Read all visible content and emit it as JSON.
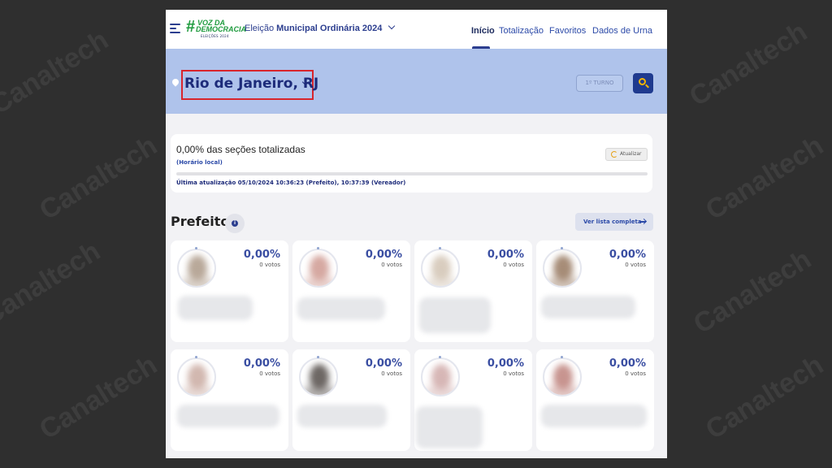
{
  "watermark": "Canaltech",
  "header": {
    "logo": {
      "hash": "#",
      "line1": "VOZ DA",
      "line2": "DEMOCRACIA",
      "sub": "ELEIÇÕES 2024"
    },
    "election_prefix": "Eleição",
    "election_name": "Municipal Ordinária 2024",
    "nav": [
      "Início",
      "Totalização",
      "Favoritos",
      "Dados de Urna"
    ],
    "active_nav": "Início"
  },
  "location": {
    "city": "Rio de Janeiro, RJ",
    "turno": "1º TURNO"
  },
  "status": {
    "percent_text": "0,00% das seções totalizadas",
    "percent_value": 0.0,
    "local_time": "(Horário local)",
    "last_update": "Última atualização 05/10/2024 10:36:23 (Prefeito), 10:37:39 (Vereador)",
    "refresh_label": "Atualizar"
  },
  "section": {
    "title": "Prefeito",
    "info": "i",
    "see_all": "Ver lista completa"
  },
  "candidates": [
    {
      "pct": "0,00%",
      "votes": "0 votos",
      "tone": "#b9a99a"
    },
    {
      "pct": "0,00%",
      "votes": "0 votos",
      "tone": "#d6a9a2"
    },
    {
      "pct": "0,00%",
      "votes": "0 votos",
      "tone": "#d9cdbf"
    },
    {
      "pct": "0,00%",
      "votes": "0 votos",
      "tone": "#a78d78"
    },
    {
      "pct": "0,00%",
      "votes": "0 votos",
      "tone": "#d2b8b0"
    },
    {
      "pct": "0,00%",
      "votes": "0 votos",
      "tone": "#6e6865"
    },
    {
      "pct": "0,00%",
      "votes": "0 votos",
      "tone": "#d7b7b6"
    },
    {
      "pct": "0,00%",
      "votes": "0 votos",
      "tone": "#c89590"
    }
  ],
  "colors": {
    "accent": "#2c3e8f",
    "banner": "#afc3eb",
    "highlight_box": "#d8252c",
    "logo_green": "#1f9b3e",
    "search_icon": "#f4b400"
  },
  "icons": [
    "menu-icon",
    "location-pin-icon",
    "chevron-down-icon",
    "search-icon",
    "refresh-icon",
    "info-icon",
    "arrow-right-icon"
  ]
}
